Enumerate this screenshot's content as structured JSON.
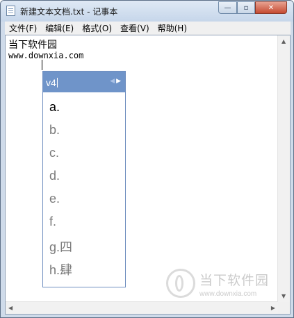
{
  "window": {
    "title": "新建文本文档.txt - 记事本",
    "controls": {
      "minimize": "—",
      "maximize": "▫",
      "close": "✕"
    }
  },
  "menu": [
    "文件(F)",
    "编辑(E)",
    "格式(O)",
    "查看(V)",
    "帮助(H)"
  ],
  "editor": {
    "lines": [
      "当下软件园",
      "www.downxia.com"
    ]
  },
  "ime": {
    "input": "v4",
    "nav": {
      "prev": "◀",
      "next": "▶"
    },
    "candidates": [
      "a.",
      "b.",
      "c.",
      "d.",
      "e.",
      "f.",
      "g.四",
      "h.肆"
    ],
    "selected_index": 0
  },
  "watermark": {
    "text": "当下软件园",
    "url": "www.downxia.com"
  },
  "colors": {
    "ime_header": "#6f94c9",
    "close_button": "#c54a31"
  },
  "icons": {
    "app": "notepad-icon",
    "scroll_up": "arrow-up",
    "scroll_down": "arrow-down",
    "scroll_left": "arrow-left",
    "scroll_right": "arrow-right"
  }
}
